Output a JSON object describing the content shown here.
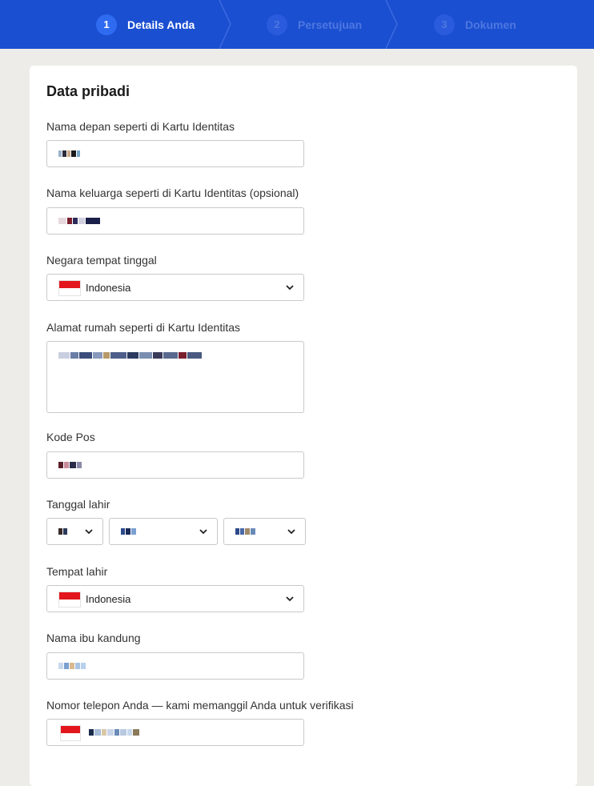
{
  "stepper": {
    "steps": [
      {
        "number": "1",
        "label": "Details Anda"
      },
      {
        "number": "2",
        "label": "Persetujuan"
      },
      {
        "number": "3",
        "label": "Dokumen"
      }
    ]
  },
  "form": {
    "title": "Data pribadi",
    "first_name": {
      "label": "Nama depan seperti di Kartu Identitas"
    },
    "family_name": {
      "label": "Nama keluarga seperti di Kartu Identitas (opsional)"
    },
    "country": {
      "label": "Negara tempat tinggal",
      "value": "Indonesia"
    },
    "address": {
      "label": "Alamat rumah seperti di Kartu Identitas"
    },
    "postal_code": {
      "label": "Kode Pos"
    },
    "birth_date": {
      "label": "Tanggal lahir"
    },
    "birth_place": {
      "label": "Tempat lahir",
      "value": "Indonesia"
    },
    "mother_name": {
      "label": "Nama ibu kandung"
    },
    "phone": {
      "label": "Nomor telepon Anda — kami memanggil Anda untuk verifikasi"
    }
  },
  "icons": {
    "caret": "chevron-down-icon",
    "flag": "indonesia-flag-icon"
  },
  "colors": {
    "header_bg": "#1b4fd1",
    "page_bg": "#edece8",
    "flag_red": "#e3161d"
  }
}
